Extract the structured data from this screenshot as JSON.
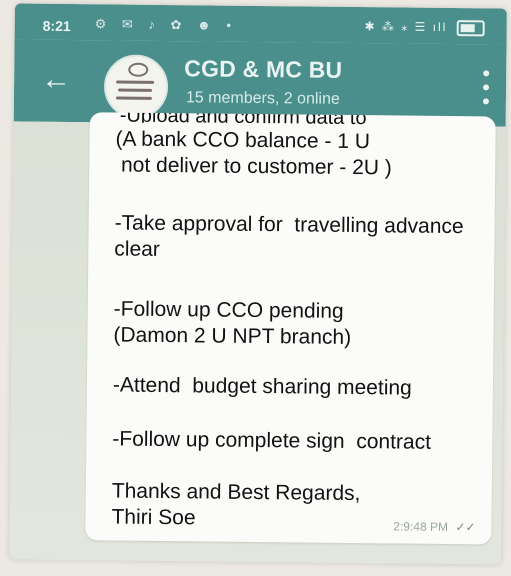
{
  "status_bar": {
    "time": "8:21",
    "left_icons": "⚙ ✉ ♪ ✿ ☻ •",
    "right_icons": "✱ ⁂ ⁎ ☰ ıll"
  },
  "header": {
    "title": "CGD & MC BU",
    "subtitle": "15 members, 2 online"
  },
  "message": {
    "cut_off_text": "-Upload and confirm data to",
    "lines": [
      "(A bank CCO balance - 1 U",
      " not deliver to customer - 2U )",
      "-Take approval for  travelling advance",
      "clear",
      "-Follow up CCO pending",
      "(Damon 2 U NPT branch)",
      "-Attend  budget sharing meeting",
      "-Follow up complete sign  contract",
      "Thanks and Best Regards,",
      "Thiri Soe"
    ],
    "time": "2:9:48 PM"
  },
  "colors": {
    "header_bg": "#4a8f8c",
    "bubble_bg": "#fbfbf9",
    "chat_bg": "#dfe3d9"
  }
}
